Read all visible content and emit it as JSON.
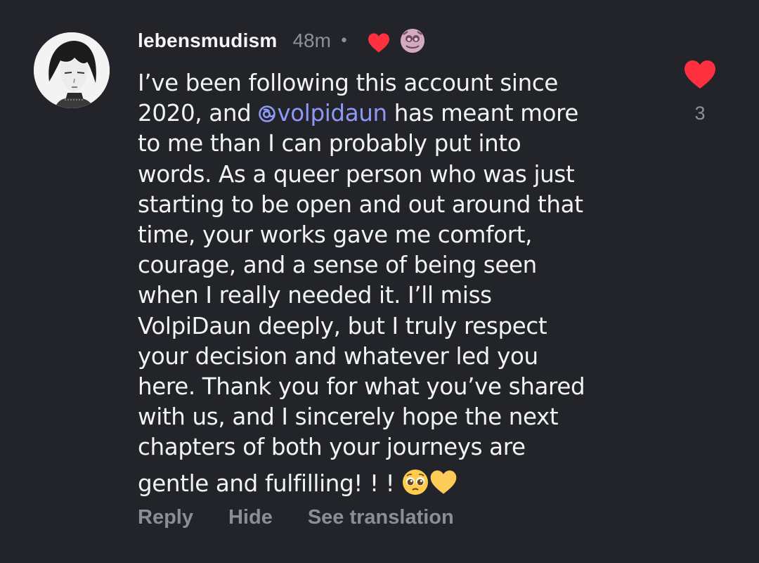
{
  "comment": {
    "username": "lebensmudism",
    "time": "48m",
    "separator": "•",
    "text_lines": {
      "l1": "I’ve been following this account since",
      "l2_before": "2020, and ",
      "mention": "volpidaun",
      "l2_after": " has meant more",
      "l3": "to me than I can probably put into",
      "l4": "words. As a queer person who was just",
      "l5": "starting to be open and out around that",
      "l6": "time, your works gave me comfort,",
      "l7": "courage, and a sense of being seen",
      "l8": "when I really needed it. I’ll miss",
      "l9": "VolpiDaun deeply, but I truly respect",
      "l10": "your decision and whatever led you",
      "l11": "here. Thank you for what you’ve shared",
      "l12": "with us, and I sincerely hope the next",
      "l13": "chapters of both your journeys are",
      "l14": "gentle and fulfilling! ! ! "
    },
    "emojis": [
      "pleading-face-emoji",
      "yellow-heart-emoji"
    ],
    "like_count": "3",
    "icons": {
      "liked_by_creator": "heart-icon",
      "creator_avatar": "creator-avatar",
      "like": "heart-icon",
      "mention": "threads-at-icon"
    }
  },
  "actions": {
    "reply": "Reply",
    "hide": "Hide",
    "see_translation": "See translation"
  },
  "colors": {
    "background": "#232429",
    "text": "#f2f3f5",
    "muted": "#8f9199",
    "mention": "#8e98f5",
    "heart": "#ff3040"
  }
}
